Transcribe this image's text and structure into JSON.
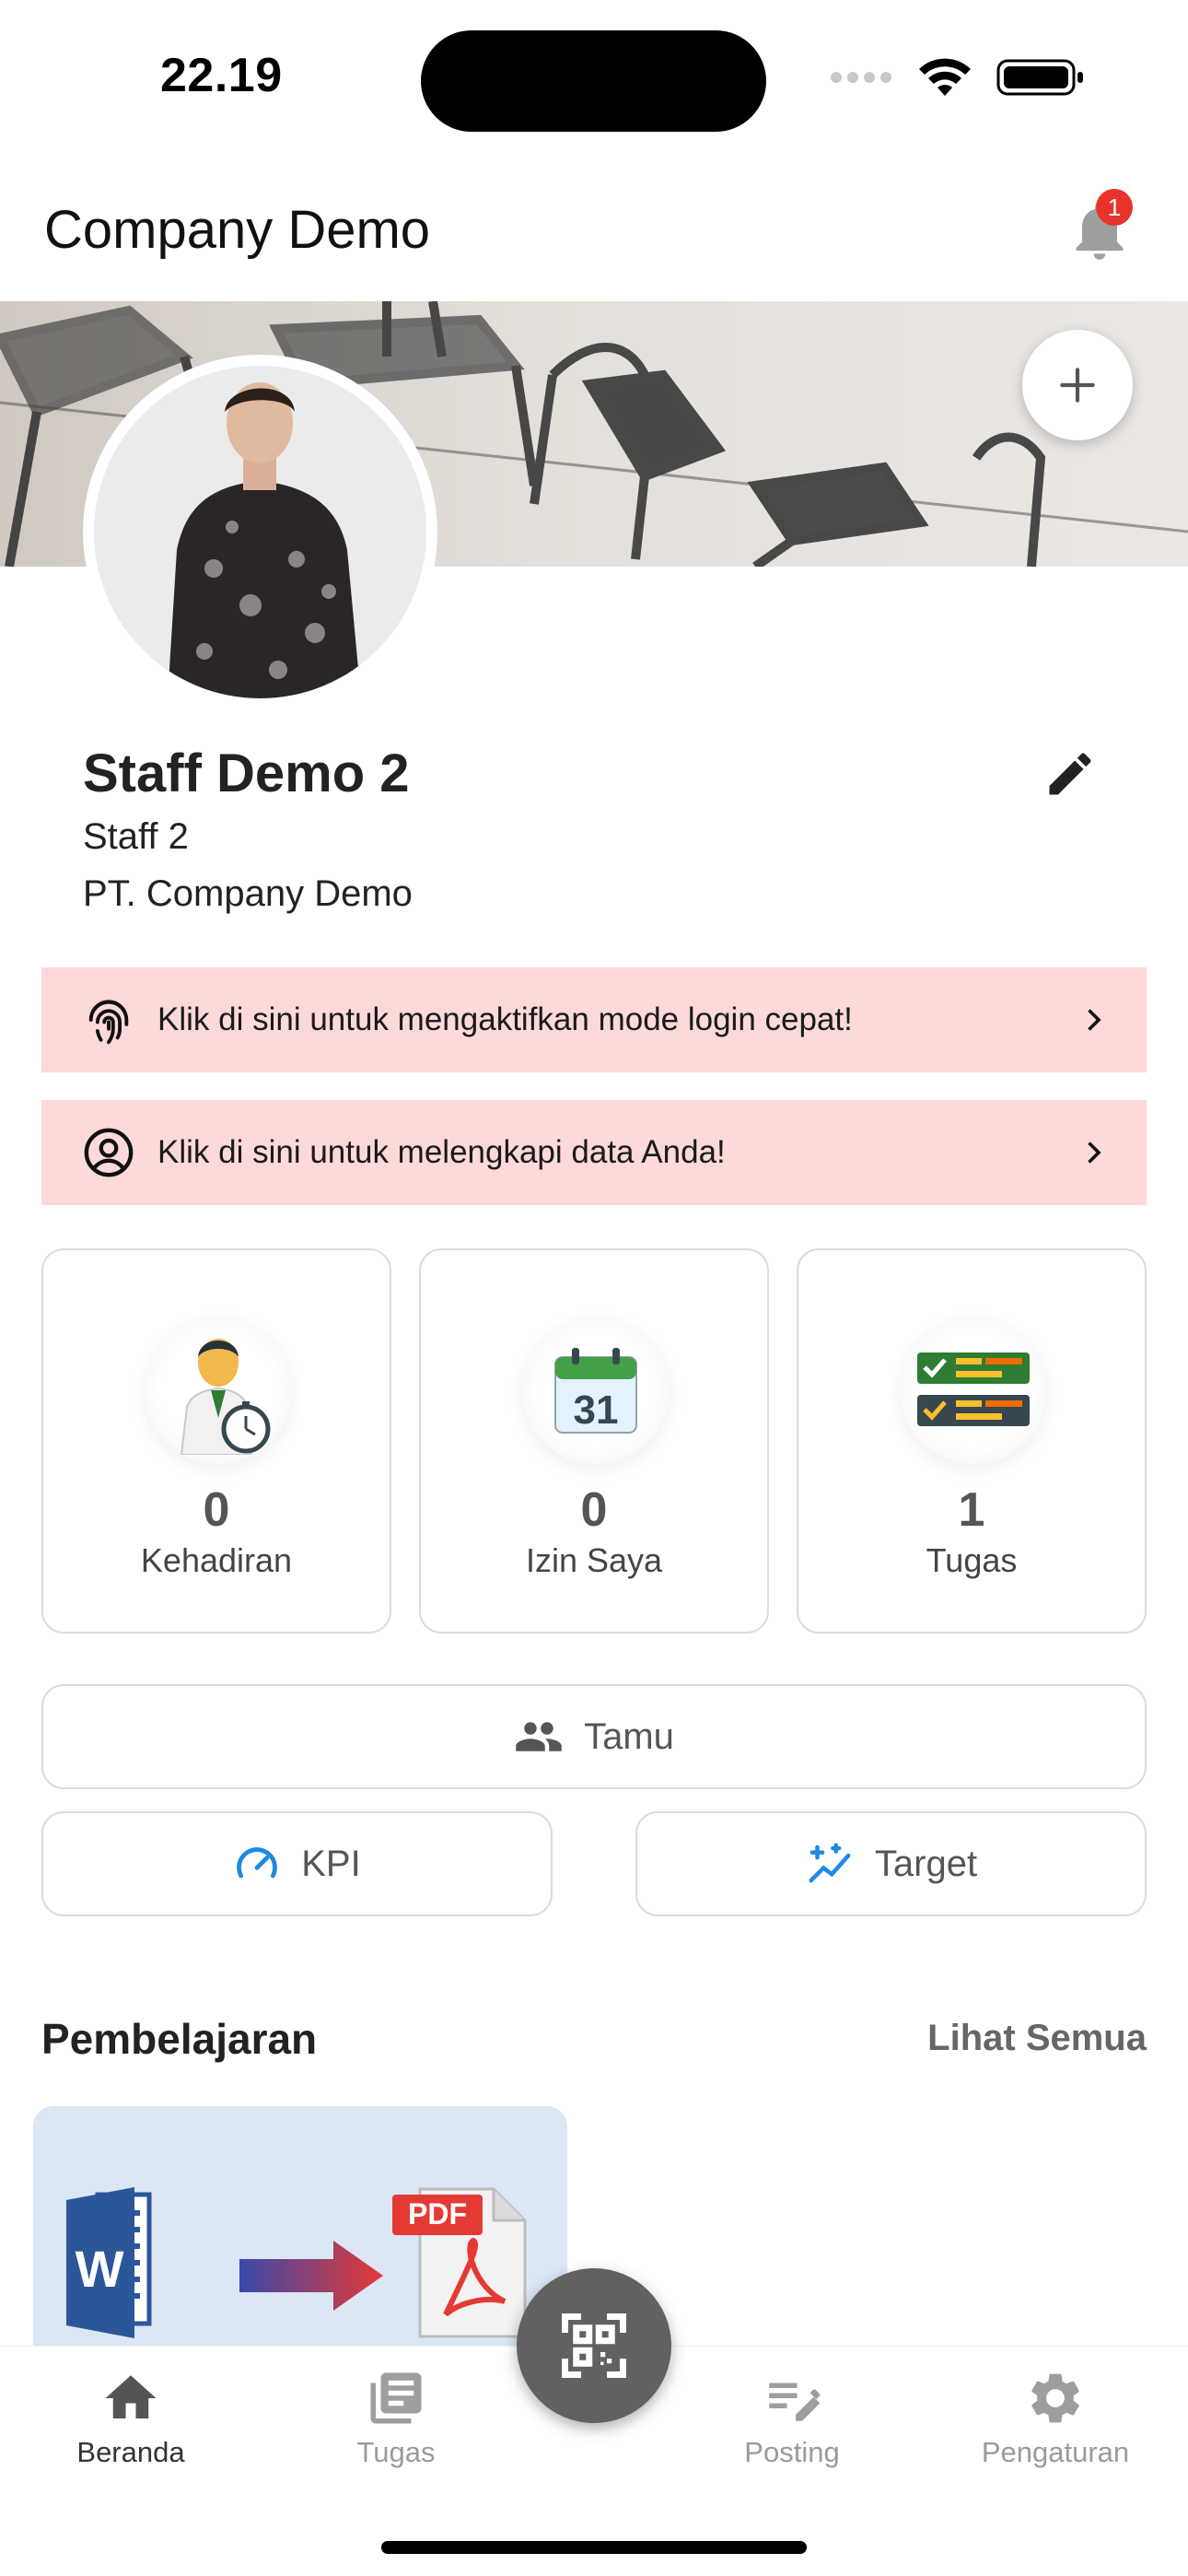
{
  "status_bar": {
    "time": "22.19"
  },
  "app_bar": {
    "title": "Company Demo",
    "notification_count": "1"
  },
  "profile": {
    "name": "Staff Demo 2",
    "role": "Staff 2",
    "company": "PT. Company Demo"
  },
  "alerts": [
    {
      "icon": "fingerprint-icon",
      "text": "Klik di sini untuk mengaktifkan mode login cepat!"
    },
    {
      "icon": "account-circle-icon",
      "text": "Klik di sini untuk melengkapi data Anda!"
    }
  ],
  "stats": [
    {
      "icon": "attendance-icon",
      "value": "0",
      "label": "Kehadiran"
    },
    {
      "icon": "calendar-icon",
      "calendar_day": "31",
      "value": "0",
      "label": "Izin Saya"
    },
    {
      "icon": "task-list-icon",
      "value": "1",
      "label": "Tugas"
    }
  ],
  "actions": {
    "guest_label": "Tamu",
    "kpi_label": "KPI",
    "target_label": "Target"
  },
  "learning": {
    "title": "Pembelajaran",
    "see_all": "Lihat Semua",
    "card_badge": "PDF",
    "card_word_letter": "W"
  },
  "bottom_nav": [
    {
      "icon": "home-icon",
      "label": "Beranda",
      "active": true
    },
    {
      "icon": "tasks-icon",
      "label": "Tugas",
      "active": false
    },
    {
      "icon": "posting-icon",
      "label": "Posting",
      "active": false
    },
    {
      "icon": "settings-icon",
      "label": "Pengaturan",
      "active": false
    }
  ],
  "colors": {
    "alert_bg": "#fdd9da",
    "accent_blue": "#1e88e5",
    "badge_red": "#e8332a",
    "fab_gray": "#616161"
  }
}
